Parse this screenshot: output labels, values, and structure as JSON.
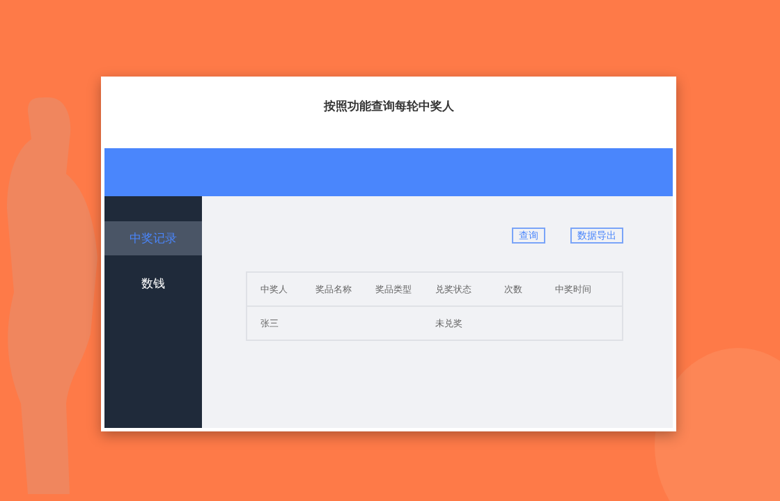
{
  "window": {
    "title": "按照功能查询每轮中奖人"
  },
  "sidebar": {
    "items": [
      {
        "label": "中奖记录",
        "selected": true
      },
      {
        "label": "数钱",
        "selected": false
      }
    ]
  },
  "toolbar": {
    "buttons": [
      "查询",
      "数据导出"
    ]
  },
  "table": {
    "columns": [
      "中奖人",
      "奖品名称",
      "奖品类型",
      "兑奖状态",
      "次数",
      "中奖时间"
    ],
    "rows": [
      [
        "张三",
        "",
        "",
        "未兑奖",
        "",
        ""
      ]
    ]
  }
}
